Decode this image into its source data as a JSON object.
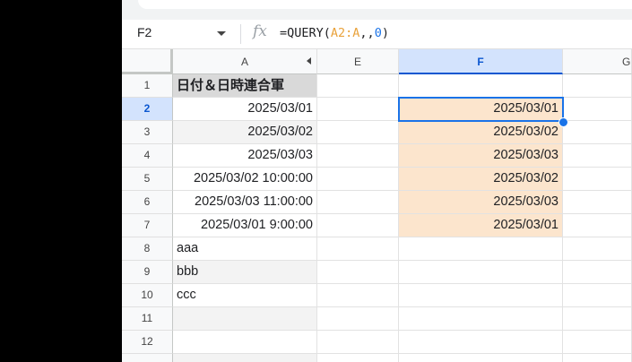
{
  "name_box": {
    "value": "F2"
  },
  "formula_bar": {
    "fx_icon": "fx",
    "prefix": "=QUERY(",
    "ref": "A2:A",
    "sep": ",,",
    "num": "0",
    "suffix": ")"
  },
  "columns": [
    "A",
    "E",
    "F",
    "G"
  ],
  "rows": [
    "1",
    "2",
    "3",
    "4",
    "5",
    "6",
    "7",
    "8",
    "9",
    "10",
    "11",
    "12"
  ],
  "column_a": {
    "header": "日付＆日時連合軍",
    "values": [
      "2025/03/01",
      "2025/03/02",
      "2025/03/03",
      "2025/03/02 10:00:00",
      "2025/03/03 11:00:00",
      "2025/03/01 9:00:00",
      "aaa",
      "bbb",
      "ccc"
    ]
  },
  "column_f": {
    "values": [
      "2025/03/01",
      "2025/03/02",
      "2025/03/03",
      "2025/03/02",
      "2025/03/03",
      "2025/03/01"
    ]
  },
  "colors": {
    "accent": "#1a73e8",
    "header_fill": "#d9d9d9",
    "result_fill": "#fce5cd"
  }
}
